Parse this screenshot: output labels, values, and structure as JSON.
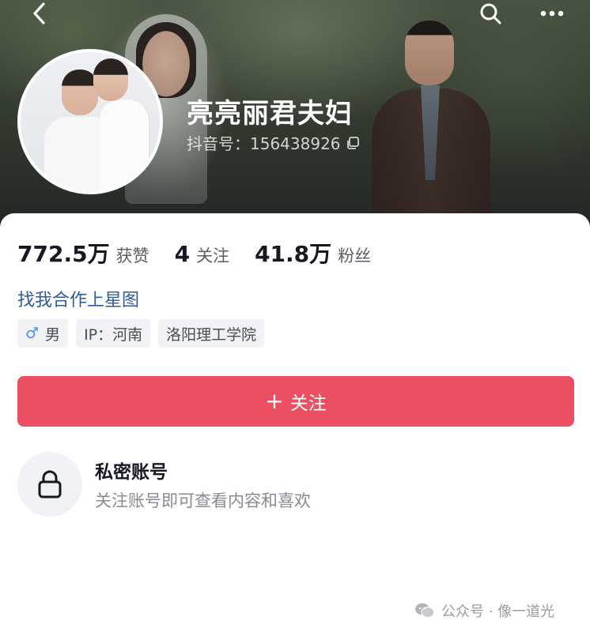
{
  "header": {
    "name": "亮亮丽君夫妇",
    "douyin_id": "抖音号：156438926",
    "icons": [
      "back-icon",
      "search-icon",
      "more-icon",
      "copy-icon"
    ]
  },
  "stats": [
    {
      "value": "772.5万",
      "label": "获赞"
    },
    {
      "value": "4",
      "label": "关注"
    },
    {
      "value": "41.8万",
      "label": "粉丝"
    }
  ],
  "cooperate_link": "找我合作上星图",
  "tags": {
    "gender": "男",
    "gender_symbol": "♂",
    "ip": "IP：河南",
    "school": "洛阳理工学院"
  },
  "follow_button": {
    "plus": "+",
    "label": "关注"
  },
  "private_account": {
    "title": "私密账号",
    "subtitle": "关注账号即可查看内容和喜欢"
  },
  "watermark": "公众号 · 像一道光",
  "colors": {
    "follow_button": "#ea4f62",
    "link": "#2f5b9c",
    "gender_icon": "#4d8ff0"
  }
}
